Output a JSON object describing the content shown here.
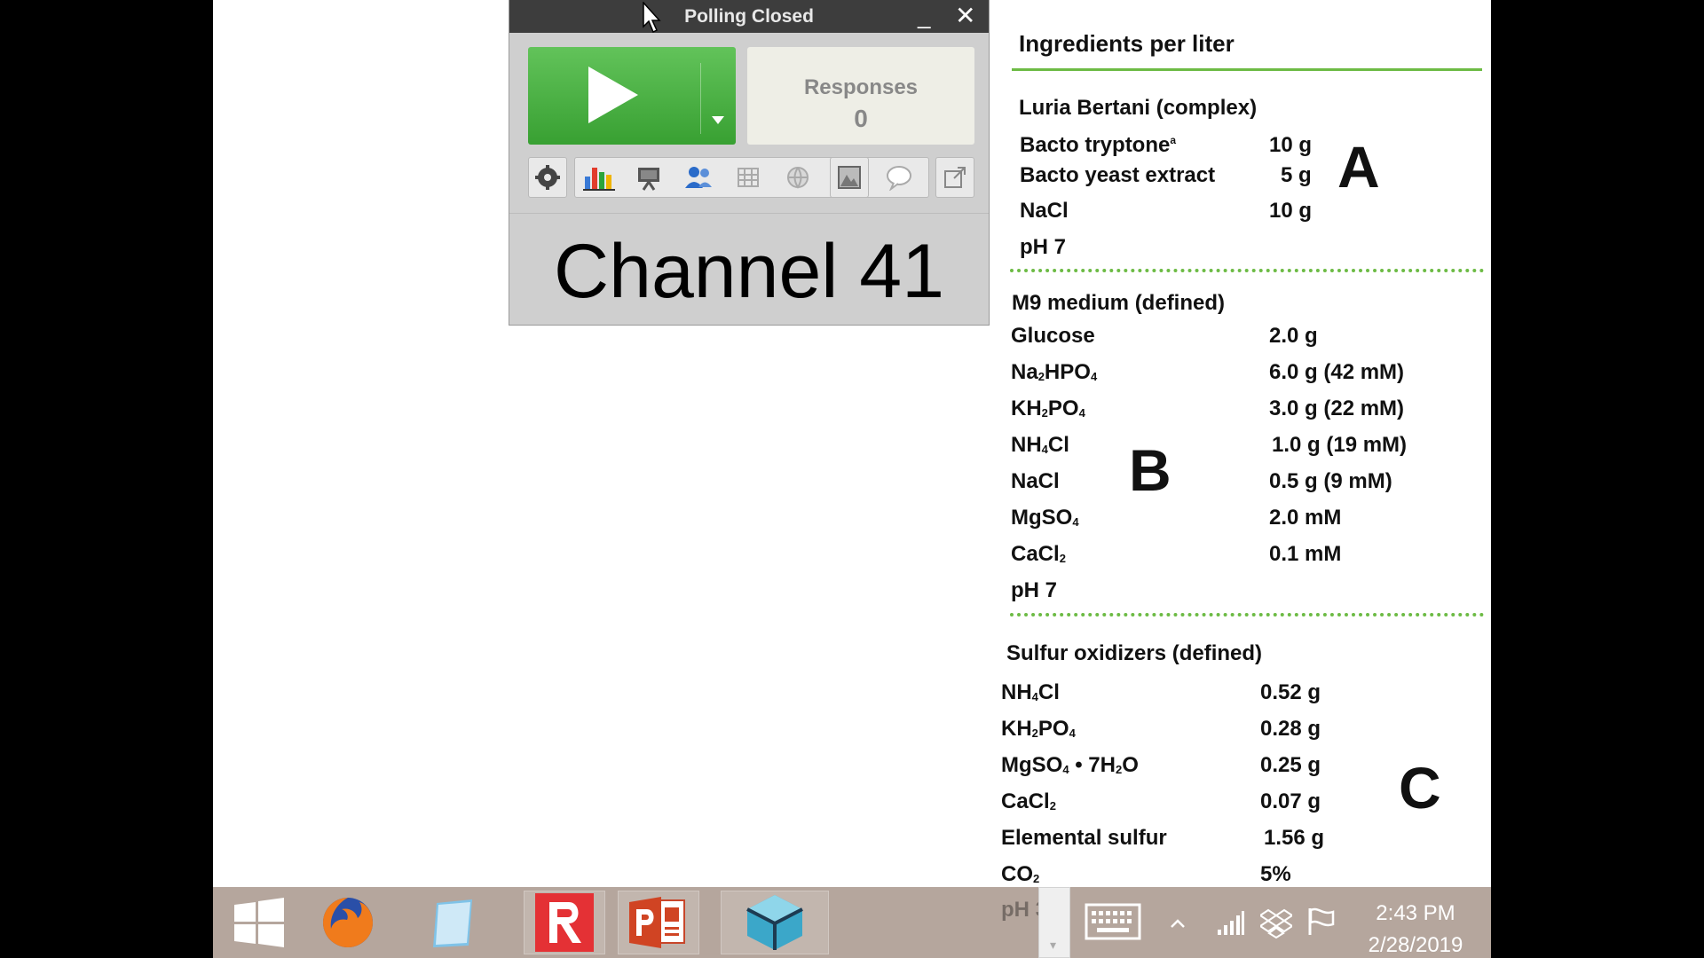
{
  "poll": {
    "title": "Polling Closed",
    "responses_label": "Responses",
    "responses_count": "0",
    "channel": "Channel 41",
    "toolbar_icons": [
      "gear-icon",
      "bar-chart-icon",
      "presentation-icon",
      "users-icon",
      "grid-icon",
      "globe-icon",
      "photo-icon",
      "speech-bubble-icon",
      "export-icon"
    ]
  },
  "slide": {
    "heading": "Ingredients per liter",
    "a": {
      "title": "Luria Bertani (complex)",
      "letter": "A",
      "rows": [
        {
          "name": "Bacto tryptone",
          "sup": "a",
          "amount": "10 g"
        },
        {
          "name": "Bacto yeast extract",
          "amount": "5 g"
        },
        {
          "name": "NaCl",
          "amount": "10 g"
        }
      ],
      "ph": "pH 7"
    },
    "b": {
      "title": "M9 medium (defined)",
      "letter": "B",
      "rows": [
        {
          "name": "Glucose",
          "amount": "2.0 g"
        },
        {
          "p1": "Na",
          "s1": "2",
          "p2": "HPO",
          "s2": "4",
          "amount": "6.0 g (42 mM)"
        },
        {
          "p1": "KH",
          "s1": "2",
          "p2": "PO",
          "s2": "4",
          "amount": "3.0 g (22 mM)"
        },
        {
          "p1": "NH",
          "s1": "4",
          "p2": "Cl",
          "amount": "1.0 g (19 mM)"
        },
        {
          "name": "NaCl",
          "amount": "0.5 g (9 mM)"
        },
        {
          "p1": "MgSO",
          "s1": "4",
          "amount": "2.0 mM"
        },
        {
          "p1": "CaCl",
          "s1": "2",
          "amount": "0.1 mM"
        }
      ],
      "ph": "pH 7"
    },
    "c": {
      "title": "Sulfur oxidizers (defined)",
      "letter": "C",
      "rows": [
        {
          "p1": "NH",
          "s1": "4",
          "p2": "Cl",
          "amount": "0.52 g"
        },
        {
          "p1": "KH",
          "s1": "2",
          "p2": "PO",
          "s2": "4",
          "amount": "0.28 g"
        },
        {
          "p1": "MgSO",
          "s1": "4",
          "p2": " • 7H",
          "s2": "2",
          "p3": "O",
          "amount": "0.25 g"
        },
        {
          "p1": "CaCl",
          "s1": "2",
          "amount": "0.07 g"
        },
        {
          "name": "Elemental sulfur",
          "amount": "1.56 g"
        },
        {
          "p1": "CO",
          "s1": "2",
          "amount": "5%"
        }
      ],
      "ph": "pH 3"
    }
  },
  "taskbar": {
    "apps": [
      "windows-start",
      "firefox",
      "notepad",
      "response-app",
      "powerpoint",
      "3d-app"
    ],
    "time": "2:43 PM",
    "date": "2/28/2019"
  },
  "colors": {
    "accent_green": "#6dbb45",
    "play_green": "#4cb446",
    "taskbar": "#b5a69d"
  }
}
